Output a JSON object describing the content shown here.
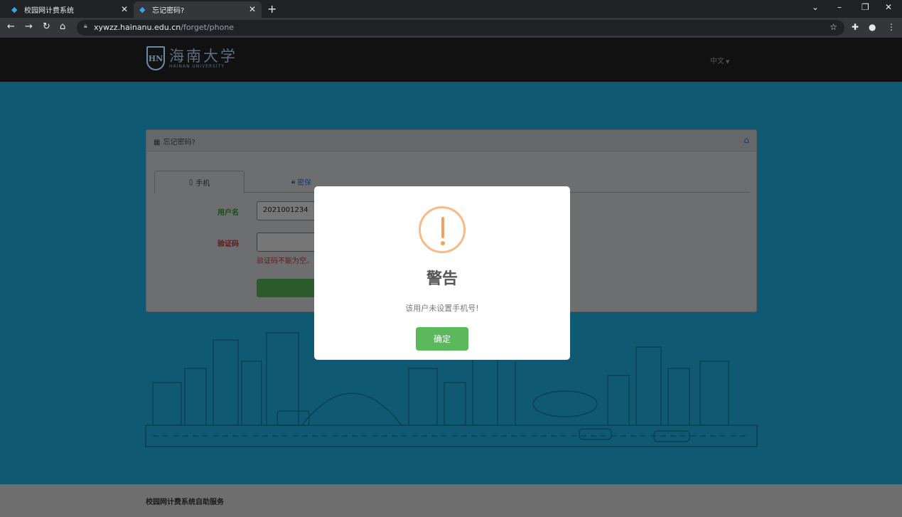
{
  "browser": {
    "tabs": [
      {
        "title": "校园网计费系统",
        "active": false
      },
      {
        "title": "忘记密码?",
        "active": true
      }
    ],
    "url_host": "xywzz.hainanu.edu.cn",
    "url_path": "/forget/phone"
  },
  "header": {
    "logo_cn": "海南大学",
    "logo_en": "HAINAN UNIVERSITY",
    "logo_badge": "HN",
    "lang": "中文"
  },
  "panel": {
    "title": "忘记密码?",
    "tabs": [
      {
        "label": "手机",
        "active": true
      },
      {
        "label": "密保",
        "active": false
      }
    ],
    "username_label": "用户名",
    "username_value": "2021001234",
    "code_label": "验证码",
    "code_error": "验证码不能为空。"
  },
  "footer": {
    "text": "校园网计费系统自助服务"
  },
  "modal": {
    "title": "警告",
    "message": "该用户未设置手机号!",
    "confirm": "确定"
  },
  "colors": {
    "page_bg": "#1f9dbf",
    "confirm_button": "#5cb85c",
    "warning_icon": "#f8bb86"
  }
}
